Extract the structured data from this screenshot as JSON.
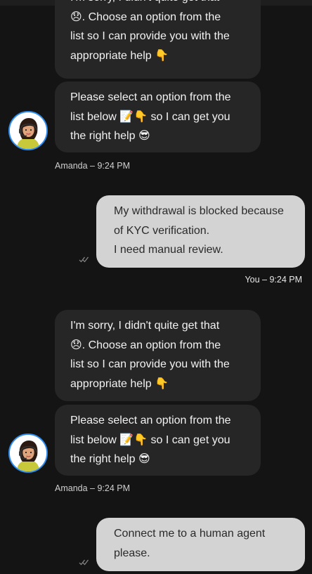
{
  "messages": {
    "m1": {
      "bubble1": "I'm sorry, I didn't quite get that\n😞. Choose an option from the\nlist so I can provide you with the\nappropriate help 👇",
      "bubble2": "Please select an option from the\nlist below 📝👇 so I can get you\nthe right help 😎",
      "meta": "Amanda – 9:24 PM"
    },
    "u1": {
      "text": "My withdrawal is blocked because\nof KYC verification.\nI need manual review.",
      "meta": "You – 9:24 PM"
    },
    "m2": {
      "bubble1": "I'm sorry, I didn't quite get that\n😞. Choose an option from the\nlist so I can provide you with the\nappropriate help 👇",
      "bubble2": "Please select an option from the\nlist below 📝👇 so I can get you\nthe right help 😎",
      "meta": "Amanda – 9:24 PM"
    },
    "u2": {
      "text": "Connect me to a human agent\nplease."
    }
  },
  "colors": {
    "background": "#141414",
    "bot_bubble": "#262626",
    "user_bubble": "#d3d3d3",
    "avatar_ring": "#2f8df0"
  }
}
